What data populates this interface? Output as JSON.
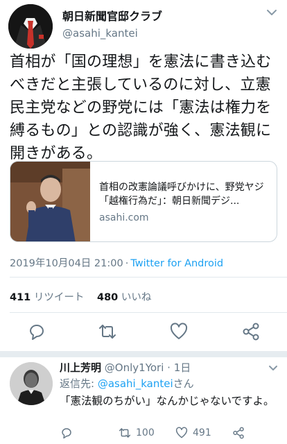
{
  "tweet": {
    "author_name": "朝日新聞官邸クラブ",
    "author_handle": "@asahi_kantei",
    "text": "首相が「国の理想」を憲法に書き込むべきだと主張しているのに対し、立憲民主党などの野党には「憲法は権力を縛るもの」との認識が強く、憲法観に開きがある。",
    "card": {
      "title": "首相の改憲論議呼びかけに、野党ヤジ「越権行為だ」：朝日新聞デジ...",
      "domain": "asahi.com"
    },
    "timestamp": "2019年10月04日 21:00",
    "meta_separator": "·",
    "source": "Twitter for Android",
    "retweets_count": "411",
    "retweets_label": "リツイート",
    "likes_count": "480",
    "likes_label": "いいね"
  },
  "reply": {
    "author_name": "川上芳明",
    "author_handle": "@Only1Yori",
    "separator": "·",
    "time": "1日",
    "reply_to_prefix": "返信先:",
    "reply_to_mention": "@asahi_kantei",
    "reply_to_suffix": "さん",
    "text": "「憲法観のちがい」なんかじゃないですよ。",
    "retweet_count": "100",
    "like_count": "491"
  },
  "icons": {
    "header_menu": "chevron-down-icon",
    "reply": "reply-icon",
    "retweet": "retweet-icon",
    "like": "heart-icon",
    "share": "share-icon"
  },
  "colors": {
    "accent": "#1da1f2",
    "secondary_text": "#657786",
    "divider": "#e1e8ed",
    "section_separator": "#e6ecf0"
  }
}
